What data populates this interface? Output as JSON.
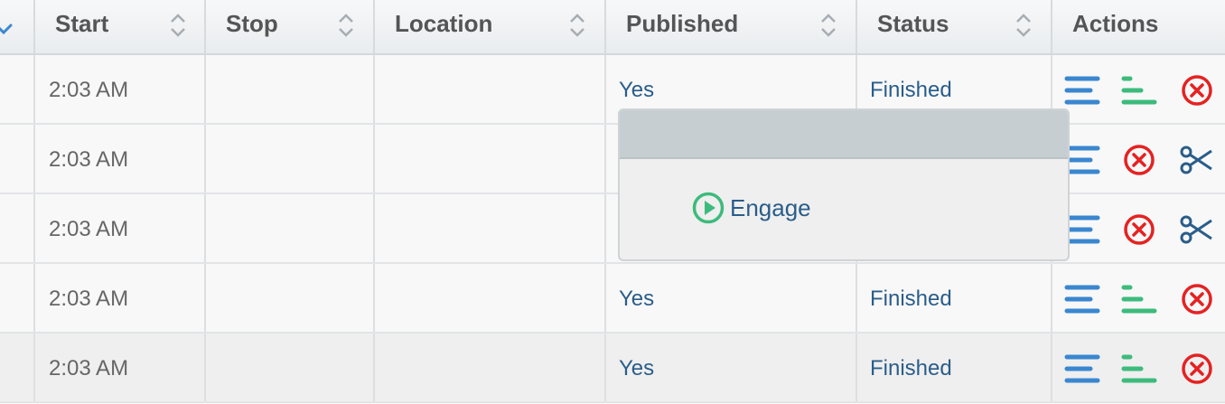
{
  "columns": [
    {
      "label": ""
    },
    {
      "label": "Start"
    },
    {
      "label": "Stop"
    },
    {
      "label": "Location"
    },
    {
      "label": "Published"
    },
    {
      "label": "Status"
    },
    {
      "label": "Actions"
    }
  ],
  "rows": [
    {
      "start": "2:03 AM",
      "stop": "",
      "location": "",
      "published": "Yes",
      "status": "Finished",
      "actions": [
        "details-icon",
        "report-icon",
        "cancel-icon"
      ]
    },
    {
      "start": "2:03 AM",
      "stop": "",
      "location": "",
      "published": "",
      "status": "",
      "actions": [
        "details-icon",
        "cancel-icon",
        "cut-icon"
      ]
    },
    {
      "start": "2:03 AM",
      "stop": "",
      "location": "",
      "published": "",
      "status": "",
      "actions": [
        "details-icon",
        "cancel-icon",
        "cut-icon"
      ]
    },
    {
      "start": "2:03 AM",
      "stop": "",
      "location": "",
      "published": "Yes",
      "status": "Finished",
      "actions": [
        "details-icon",
        "report-icon",
        "cancel-icon"
      ]
    },
    {
      "start": "2:03 AM",
      "stop": "",
      "location": "",
      "published": "Yes",
      "status": "Finished",
      "actions": [
        "details-icon",
        "report-icon",
        "cancel-icon"
      ]
    }
  ],
  "popup": {
    "item_label": "Engage",
    "item_icon": "play-circle-icon"
  },
  "colors": {
    "link": "#2a5d8a",
    "blue_icon": "#3a87d0",
    "green_icon": "#3dbb7c",
    "red_icon": "#e52222",
    "scissors": "#2a5d8a"
  }
}
